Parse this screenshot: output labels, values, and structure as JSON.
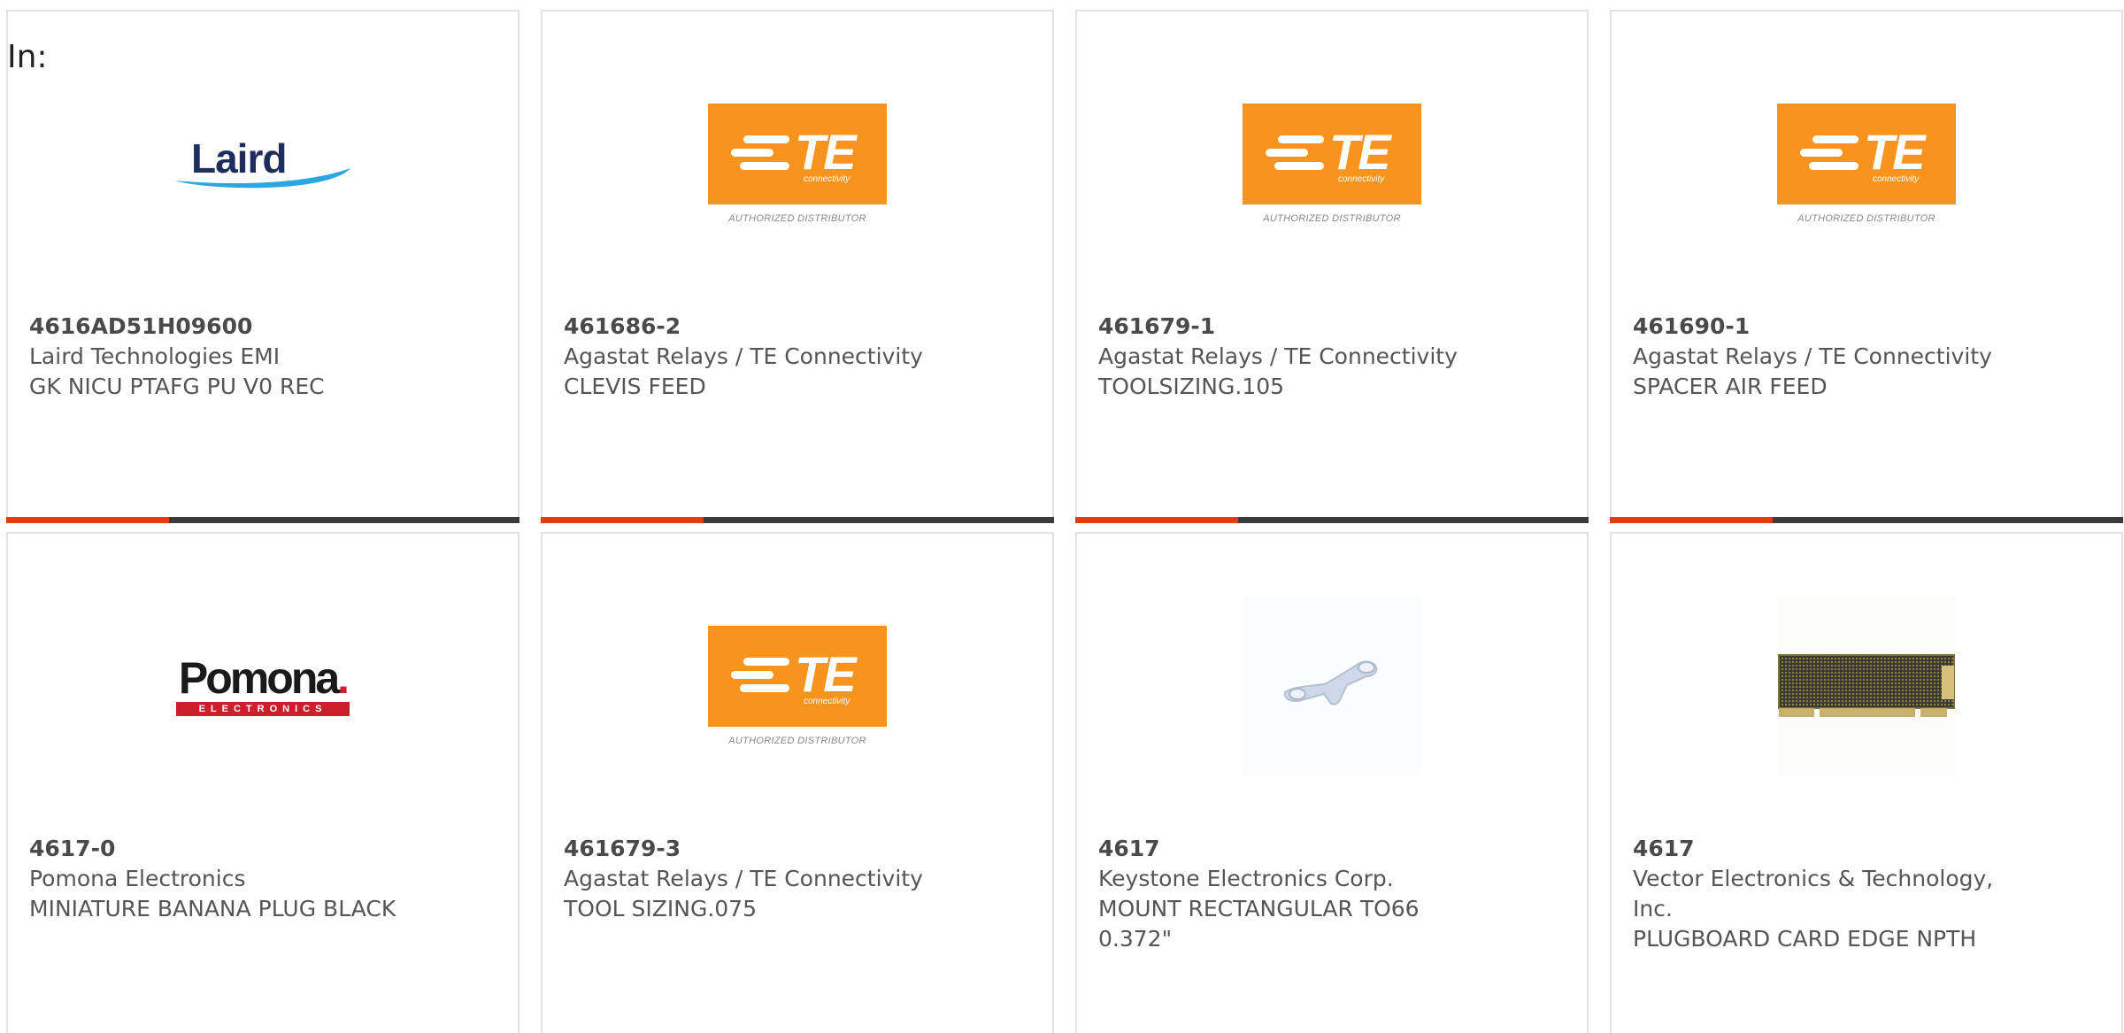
{
  "search_label": "In:",
  "colors": {
    "accent": "#e23d0a",
    "bar": "#3c3c3c",
    "te_orange": "#f7941d",
    "pomona_red": "#cc1f2d"
  },
  "products": [
    {
      "part_number": "4616AD51H09600",
      "manufacturer": "Laird Technologies EMI",
      "description": "GK NICU PTAFG PU V0 REC",
      "logo": "laird-logo",
      "logo_text": "Laird"
    },
    {
      "part_number": "461686-2",
      "manufacturer": "Agastat Relays / TE Connectivity",
      "description": "CLEVIS FEED",
      "logo": "te-logo",
      "logo_text": "TE",
      "logo_subtext": "connectivity",
      "logo_caption": "AUTHORIZED DISTRIBUTOR"
    },
    {
      "part_number": "461679-1",
      "manufacturer": "Agastat Relays / TE Connectivity",
      "description": "TOOLSIZING.105",
      "logo": "te-logo",
      "logo_text": "TE",
      "logo_subtext": "connectivity",
      "logo_caption": "AUTHORIZED DISTRIBUTOR"
    },
    {
      "part_number": "461690-1",
      "manufacturer": "Agastat Relays / TE Connectivity",
      "description": "SPACER AIR FEED",
      "logo": "te-logo",
      "logo_text": "TE",
      "logo_subtext": "connectivity",
      "logo_caption": "AUTHORIZED DISTRIBUTOR"
    },
    {
      "part_number": "4617-0",
      "manufacturer": "Pomona Electronics",
      "description": "MINIATURE BANANA PLUG BLACK",
      "logo": "pomona-logo",
      "logo_text": "Pomona",
      "logo_caption": "ELECTRONICS"
    },
    {
      "part_number": "461679-3",
      "manufacturer": "Agastat Relays / TE Connectivity",
      "description": "TOOL SIZING.075",
      "logo": "te-logo",
      "logo_text": "TE",
      "logo_subtext": "connectivity",
      "logo_caption": "AUTHORIZED DISTRIBUTOR"
    },
    {
      "part_number": "4617",
      "manufacturer": "Keystone Electronics Corp.",
      "description": "MOUNT RECTANGULAR TO66 0.372\"",
      "logo": "mount-photo"
    },
    {
      "part_number": "4617",
      "manufacturer": "Vector Electronics & Technology, Inc.",
      "description": "PLUGBOARD CARD EDGE NPTH",
      "logo": "plugboard-photo"
    }
  ]
}
